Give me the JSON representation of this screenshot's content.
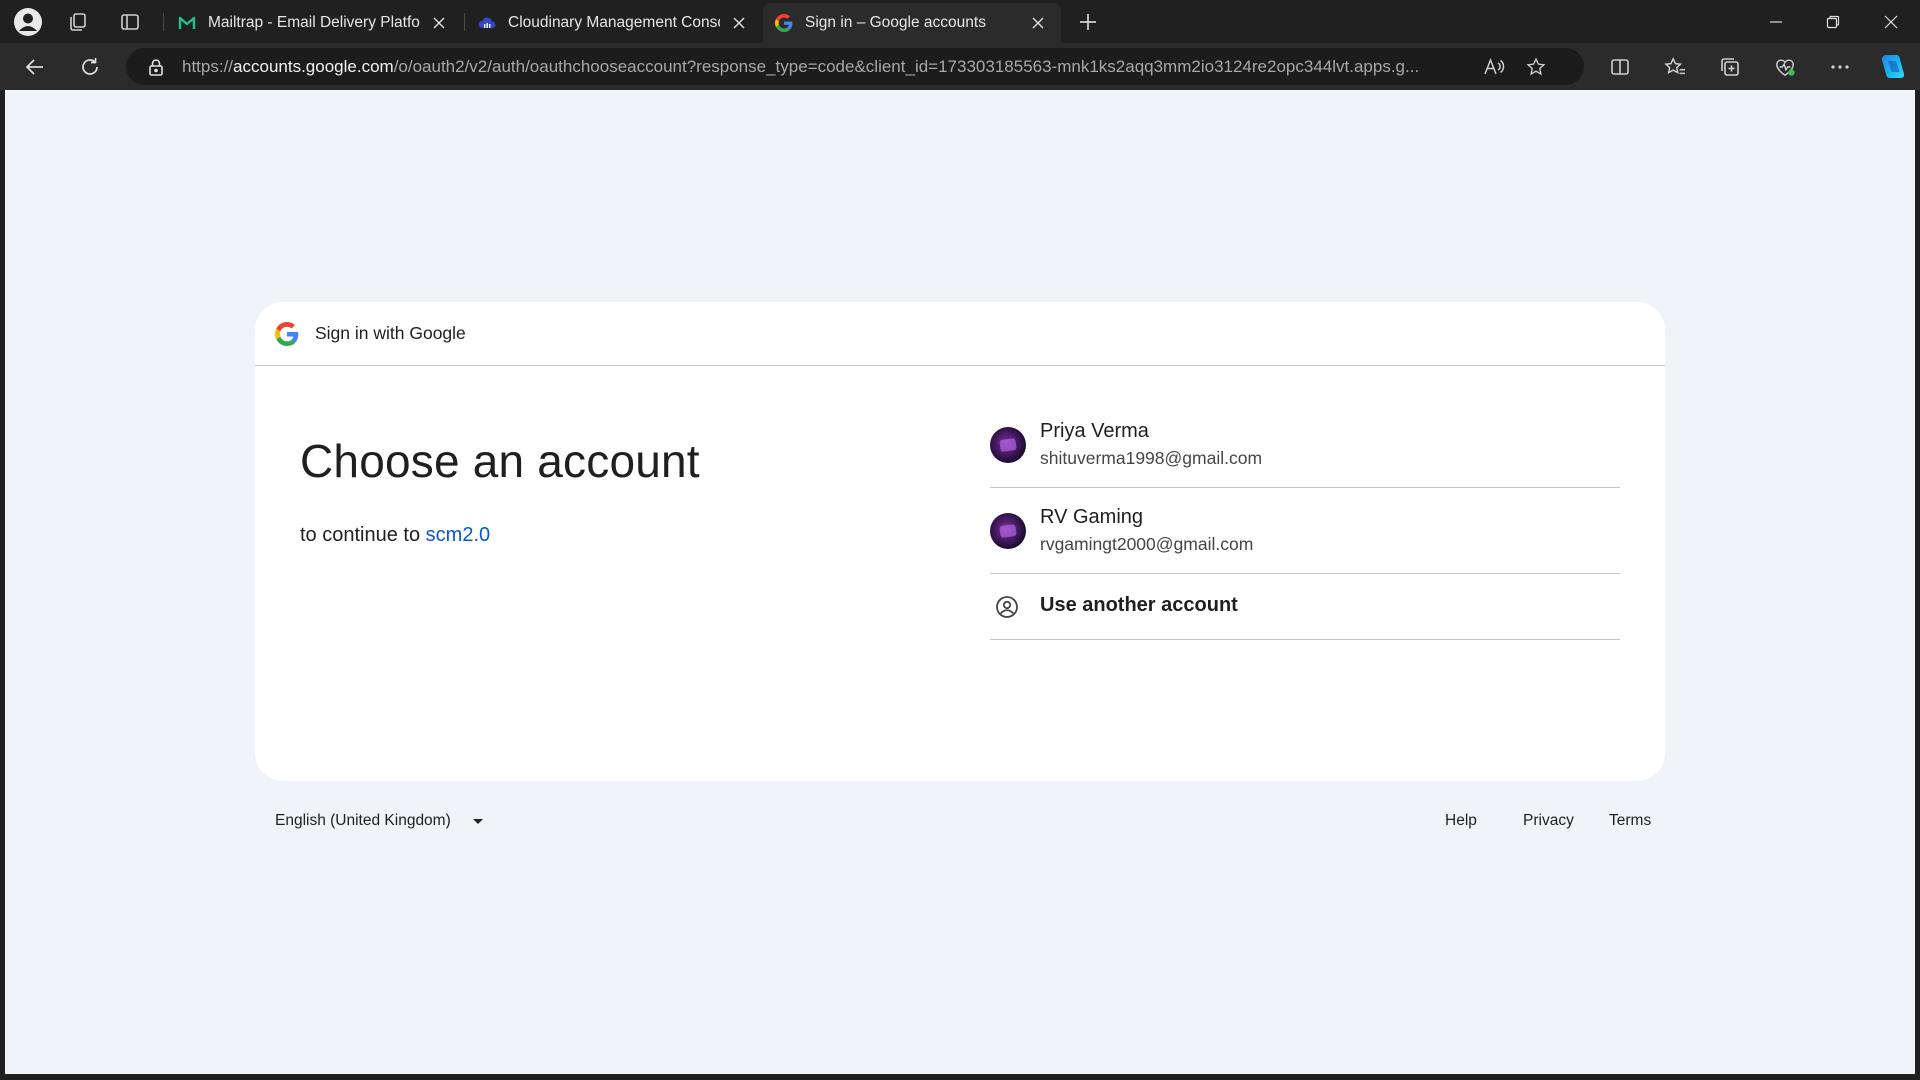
{
  "browser": {
    "tabs": [
      {
        "title": "Mailtrap - Email Delivery Platform",
        "favicon": "mailtrap-icon"
      },
      {
        "title": "Cloudinary Management Console",
        "favicon": "cloudinary-icon"
      },
      {
        "title": "Sign in – Google accounts",
        "favicon": "google-icon",
        "active": true
      }
    ],
    "address": {
      "scheme": "https://",
      "host": "accounts.google.com",
      "path": "/o/oauth2/v2/auth/oauthchooseaccount?response_type=code&client_id=173303185563-mnk1ks2aqq3mm2io3124re2opc344lvt.apps.g..."
    }
  },
  "card": {
    "header": "Sign in with Google",
    "heading": "Choose an account",
    "continue_prefix": "to continue to ",
    "app_name": "scm2.0"
  },
  "accounts": [
    {
      "name": "Priya Verma",
      "email": "shituverma1998@gmail.com"
    },
    {
      "name": "RV Gaming",
      "email": "rvgamingt2000@gmail.com"
    }
  ],
  "other_account": "Use another account",
  "footer": {
    "language": "English (United Kingdom)",
    "help": "Help",
    "privacy": "Privacy",
    "terms": "Terms"
  },
  "colors": {
    "link": "#0b57d0",
    "page_bg": "#f0f4f9",
    "chrome_bg": "#202020"
  }
}
